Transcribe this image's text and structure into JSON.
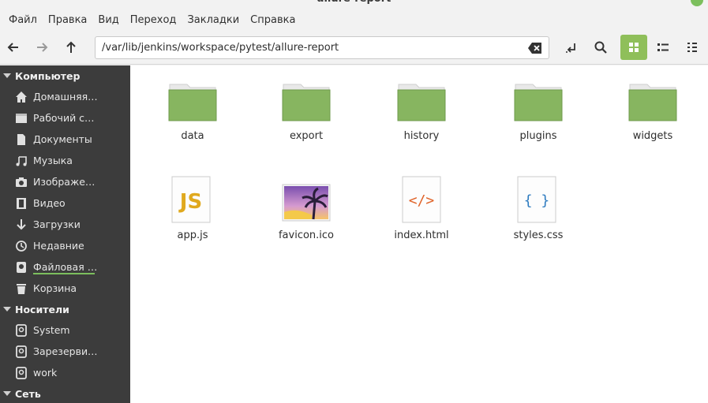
{
  "window": {
    "title": "allure-report"
  },
  "menubar": [
    "Файл",
    "Правка",
    "Вид",
    "Переход",
    "Закладки",
    "Справка"
  ],
  "toolbar": {
    "path": "/var/lib/jenkins/workspace/pytest/allure-report"
  },
  "sidebar": {
    "sections": [
      {
        "label": "Компьютер",
        "items": [
          {
            "label": "Домашняя…",
            "icon": "home-icon"
          },
          {
            "label": "Рабочий с…",
            "icon": "desktop-icon"
          },
          {
            "label": "Документы",
            "icon": "documents-icon"
          },
          {
            "label": "Музыка",
            "icon": "music-icon"
          },
          {
            "label": "Изображе…",
            "icon": "pictures-icon"
          },
          {
            "label": "Видео",
            "icon": "videos-icon"
          },
          {
            "label": "Загрузки",
            "icon": "downloads-icon"
          },
          {
            "label": "Недавние",
            "icon": "recent-icon"
          },
          {
            "label": "Файловая …",
            "icon": "filesystem-icon"
          },
          {
            "label": "Корзина",
            "icon": "trash-icon"
          }
        ]
      },
      {
        "label": "Носители",
        "items": [
          {
            "label": "System",
            "icon": "drive-icon"
          },
          {
            "label": "Зарезерви…",
            "icon": "drive-icon"
          },
          {
            "label": "work",
            "icon": "drive-icon"
          }
        ]
      },
      {
        "label": "Сеть",
        "items": []
      }
    ]
  },
  "files": [
    {
      "name": "data",
      "type": "folder"
    },
    {
      "name": "export",
      "type": "folder"
    },
    {
      "name": "history",
      "type": "folder"
    },
    {
      "name": "plugins",
      "type": "folder"
    },
    {
      "name": "widgets",
      "type": "folder"
    },
    {
      "name": "app.js",
      "type": "js",
      "glyph": "JS"
    },
    {
      "name": "favicon.ico",
      "type": "image"
    },
    {
      "name": "index.html",
      "type": "html",
      "glyph": "</>"
    },
    {
      "name": "styles.css",
      "type": "css",
      "glyph": "{ }"
    }
  ],
  "colors": {
    "accent": "#8fbf5a",
    "folder": "#87b560",
    "sidebar_bg": "#3c3c3c"
  }
}
